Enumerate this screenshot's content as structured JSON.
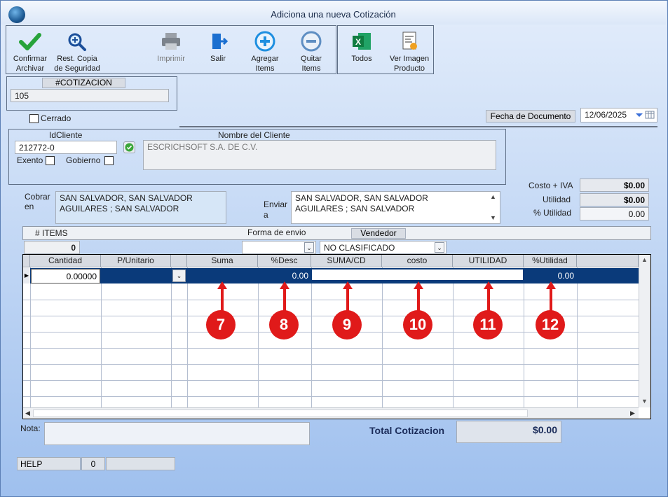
{
  "window": {
    "title": "Adiciona una nueva Cotización"
  },
  "toolbar": {
    "confirm": "Confirmar\nArchivar",
    "restore": "Rest. Copia\nde Seguridad",
    "print": "Imprimir",
    "exit": "Salir",
    "add_items": "Agregar\nItems",
    "remove_items": "Quitar\nItems",
    "all": "Todos",
    "view_image": "Ver Imagen\nProducto"
  },
  "quote": {
    "number_label": "#COTIZACION",
    "number_value": "105",
    "closed_label": "Cerrado"
  },
  "document_date": {
    "label": "Fecha de  Documento",
    "value": "12/06/2025"
  },
  "client": {
    "id_label": "IdCliente",
    "id_value": "212772-0",
    "name_label": "Nombre del Cliente",
    "name_value": "ESCRICHSOFT S.A. DE C.V.",
    "exempt_label": "Exento",
    "government_label": "Gobierno"
  },
  "addresses": {
    "bill_label": "Cobrar\nen",
    "bill_value": "SAN SALVADOR, SAN SALVADOR\nAGUILARES ; SAN SALVADOR",
    "ship_label": "Enviar\na",
    "ship_value": "SAN SALVADOR, SAN SALVADOR\nAGUILARES ; SAN SALVADOR"
  },
  "summary": {
    "cost_iva_label": "Costo + IVA",
    "cost_iva_value": "$0.00",
    "profit_label": "Utilidad",
    "profit_value": "$0.00",
    "profit_pct_label": "% Utilidad",
    "profit_pct_value": "0.00"
  },
  "options": {
    "items_label": "# ITEMS",
    "items_value": "0",
    "shipping_label": "Forma de envio",
    "shipping_value": "",
    "seller_label": "Vendedor",
    "seller_value": "NO CLASIFICADO"
  },
  "grid": {
    "columns": [
      "Cantidad",
      "P/Unitario",
      "",
      "Suma",
      "%Desc",
      "SUMA/CD",
      "costo",
      "UTILIDAD",
      "%Utilidad"
    ],
    "row": {
      "cantidad": "0.00000",
      "desc": "0.00",
      "utilidad_pct": "0.00"
    }
  },
  "annotations": [
    "7",
    "8",
    "9",
    "10",
    "11",
    "12"
  ],
  "footer": {
    "note_label": "Nota:",
    "total_label": "Total Cotizacion",
    "total_value": "$0.00",
    "help": "HELP",
    "status_count": "0"
  },
  "colors": {
    "selected_row": "#0a3a7a",
    "annotation": "#e01a1a",
    "accent": "#1b4f9a"
  }
}
